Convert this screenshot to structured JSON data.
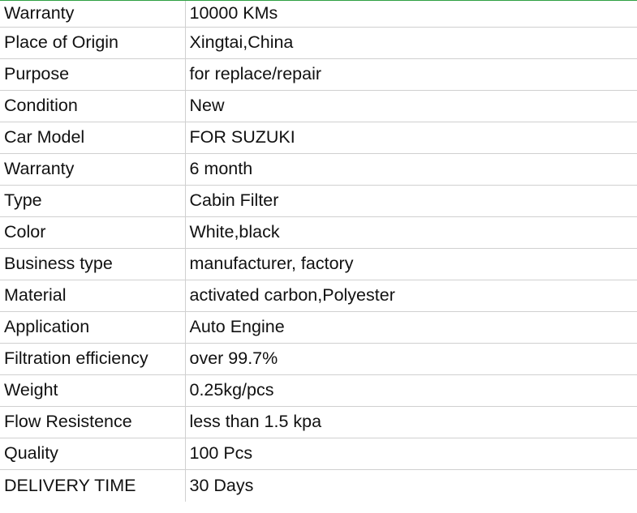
{
  "spec_table": {
    "rows": [
      {
        "label": "Warranty",
        "value": "10000 KMs"
      },
      {
        "label": "Place of Origin",
        "value": "Xingtai,China"
      },
      {
        "label": "Purpose",
        "value": "for replace/repair"
      },
      {
        "label": "Condition",
        "value": "New"
      },
      {
        "label": "Car Model",
        "value": "FOR SUZUKI"
      },
      {
        "label": "Warranty",
        "value": "6 month"
      },
      {
        "label": "Type",
        "value": "Cabin Filter"
      },
      {
        "label": "Color",
        "value": "White,black"
      },
      {
        "label": "Business type",
        "value": "manufacturer, factory"
      },
      {
        "label": "Material",
        "value": "activated carbon,Polyester"
      },
      {
        "label": "Application",
        "value": "Auto Engine"
      },
      {
        "label": "Filtration efficiency",
        "value": "over 99.7%"
      },
      {
        "label": "Weight",
        "value": "0.25kg/pcs"
      },
      {
        "label": "Flow Resistence",
        "value": "less than 1.5 kpa"
      },
      {
        "label": "Quality",
        "value": "100 Pcs"
      },
      {
        "label": "DELIVERY TIME",
        "value": "30 Days"
      }
    ]
  },
  "colors": {
    "top_border": "#2ea043",
    "grid_line": "#d0d0d0",
    "text": "#111111"
  }
}
